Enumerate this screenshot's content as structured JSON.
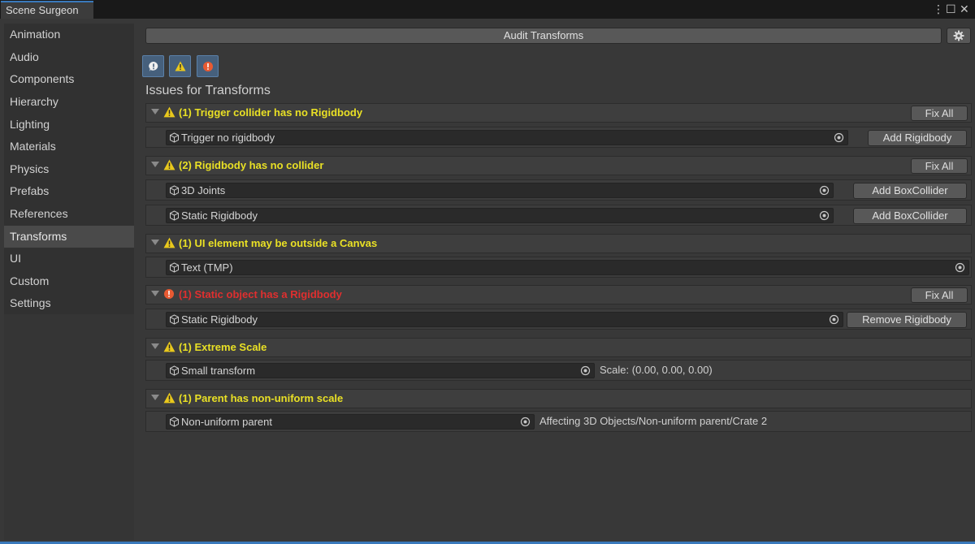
{
  "window": {
    "tab_title": "Scene Surgeon",
    "menu_glyph": "⋮",
    "maximize_glyph": "☐",
    "close_glyph": "✕"
  },
  "sidebar": {
    "items": [
      {
        "label": "Animation"
      },
      {
        "label": "Audio"
      },
      {
        "label": "Components"
      },
      {
        "label": "Hierarchy"
      },
      {
        "label": "Lighting"
      },
      {
        "label": "Materials"
      },
      {
        "label": "Physics"
      },
      {
        "label": "Prefabs"
      },
      {
        "label": "References"
      },
      {
        "label": "Transforms",
        "active": true
      },
      {
        "label": "UI"
      },
      {
        "label": "Custom"
      },
      {
        "label": "Settings"
      }
    ]
  },
  "toolbar": {
    "audit_label": "Audit Transforms",
    "gear_icon": "gear-icon",
    "filters": [
      {
        "icon": "info-icon"
      },
      {
        "icon": "warning-icon"
      },
      {
        "icon": "error-icon"
      }
    ]
  },
  "issues_title": "Issues for Transforms",
  "colors": {
    "warning": "#e9e025",
    "error": "#e02f2f",
    "accent": "#3a79bb"
  },
  "issues": [
    {
      "title": "(1) Trigger collider has no Rigidbody",
      "severity": "warning",
      "fix_all": "Fix All",
      "rows": [
        {
          "object": "Trigger no rigidbody",
          "action": "Add Rigidbody"
        }
      ]
    },
    {
      "title": "(2) Rigidbody has no collider",
      "severity": "warning",
      "fix_all": "Fix All",
      "rows": [
        {
          "object": "3D Joints",
          "action": "Add BoxCollider"
        },
        {
          "object": "Static Rigidbody",
          "action": "Add BoxCollider"
        }
      ]
    },
    {
      "title": "(1) UI element may be outside a Canvas",
      "severity": "warning",
      "rows": [
        {
          "object": "Text (TMP)"
        }
      ]
    },
    {
      "title": "(1) Static object has a Rigidbody",
      "severity": "error",
      "fix_all": "Fix All",
      "rows": [
        {
          "object": "Static Rigidbody",
          "action": "Remove Rigidbody"
        }
      ]
    },
    {
      "title": "(1) Extreme Scale",
      "severity": "warning",
      "rows": [
        {
          "object": "Small transform",
          "info": "Scale: (0.00, 0.00, 0.00)"
        }
      ]
    },
    {
      "title": "(1) Parent has non-uniform scale",
      "severity": "warning",
      "rows": [
        {
          "object": "Non-uniform parent",
          "info": "Affecting 3D Objects/Non-uniform parent/Crate 2"
        }
      ]
    }
  ]
}
